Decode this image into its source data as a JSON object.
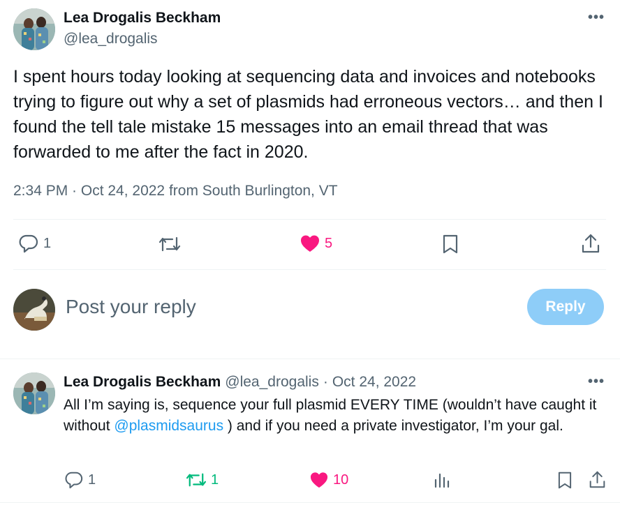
{
  "tweet": {
    "author_name": "Lea Drogalis Beckham",
    "author_handle": "@lea_drogalis",
    "more_label": "•••",
    "text": "I spent hours today looking at sequencing data and invoices and notebooks trying to figure out why a set of plasmids had erroneous vectors… and then I found the tell tale mistake 15 messages into an email thread that was forwarded to me after the fact in 2020.",
    "timestamp": "2:34 PM · Oct 24, 2022 from South Burlington, VT",
    "actions": {
      "reply_count": "1",
      "like_count": "5"
    }
  },
  "compose": {
    "placeholder": "Post your reply",
    "button_label": "Reply"
  },
  "reply": {
    "author_name": "Lea Drogalis Beckham",
    "author_handle": "@lea_drogalis",
    "separator": "·",
    "date": "Oct 24, 2022",
    "more_label": "•••",
    "text_before": "All I’m saying is, sequence your full plasmid EVERY TIME (wouldn’t have caught it without ",
    "mention": "@plasmidsaurus",
    "text_after": " ) and if you need a private investigator, I’m your gal.",
    "actions": {
      "reply_count": "1",
      "repost_count": "1",
      "like_count": "10"
    }
  },
  "colors": {
    "like": "#f91880",
    "repost": "#00ba7c",
    "link": "#1d9bf0",
    "muted": "#536471"
  }
}
